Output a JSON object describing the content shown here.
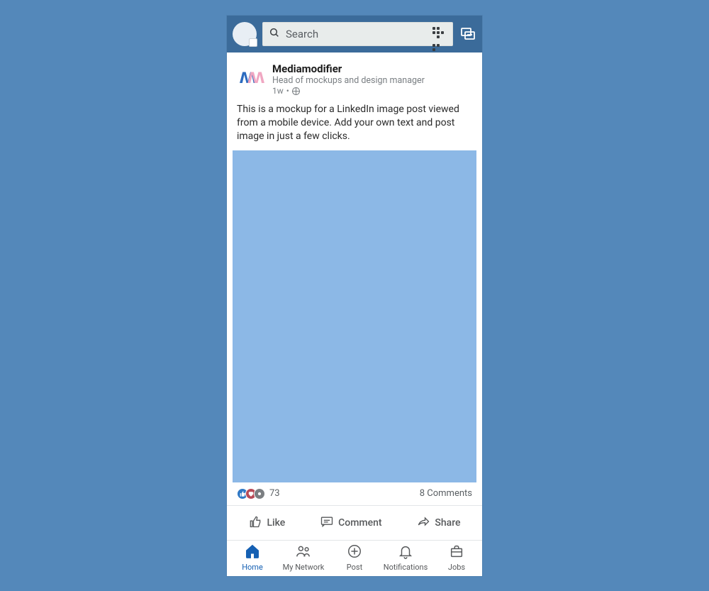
{
  "topbar": {
    "search_placeholder": "Search"
  },
  "post": {
    "author_name": "Mediamodifier",
    "author_sub": "Head of mockups and design manager",
    "time": "1w",
    "body_text": "This is a mockup for a LinkedIn image post viewed from a mobile device. Add your own text and post image in just a few clicks.",
    "reaction_count": "73",
    "comments_label": "8 Comments"
  },
  "actions": {
    "like": "Like",
    "comment": "Comment",
    "share": "Share"
  },
  "nav": {
    "home": "Home",
    "network": "My Network",
    "post": "Post",
    "notifications": "Notifications",
    "jobs": "Jobs"
  }
}
